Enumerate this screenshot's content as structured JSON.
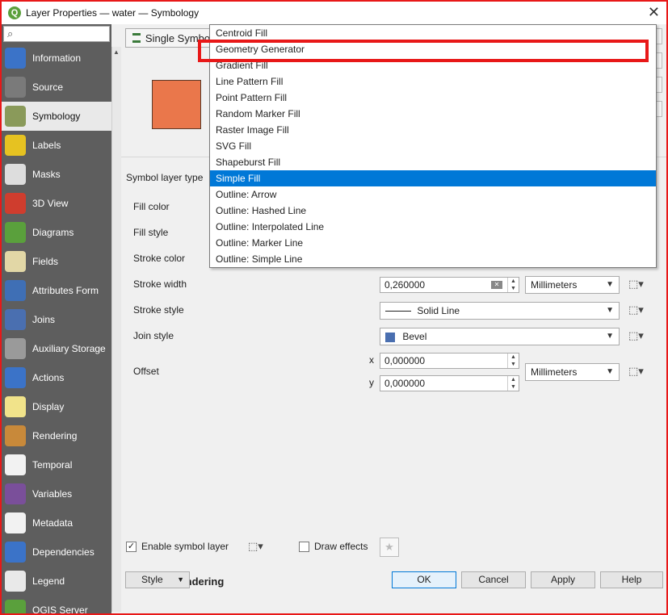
{
  "window": {
    "title": "Layer Properties — water — Symbology",
    "app_icon_letter": "Q"
  },
  "sidebar": {
    "items": [
      {
        "label": "Information",
        "icon": "info-icon",
        "color": "#3b73c8"
      },
      {
        "label": "Source",
        "icon": "source-gear-icon",
        "color": "#7a7a7a"
      },
      {
        "label": "Symbology",
        "icon": "paintbrush-icon",
        "color": "#8a9a5a",
        "active": true
      },
      {
        "label": "Labels",
        "icon": "abc-labels-icon",
        "color": "#e6c221"
      },
      {
        "label": "Masks",
        "icon": "abc-masks-icon",
        "color": "#dddddd"
      },
      {
        "label": "3D View",
        "icon": "cube-icon",
        "color": "#cf3d2e"
      },
      {
        "label": "Diagrams",
        "icon": "diagram-icon",
        "color": "#5aa03c"
      },
      {
        "label": "Fields",
        "icon": "fields-icon",
        "color": "#e2d7a6"
      },
      {
        "label": "Attributes Form",
        "icon": "form-icon",
        "color": "#3f6fb5"
      },
      {
        "label": "Joins",
        "icon": "joins-icon",
        "color": "#4a6fb0"
      },
      {
        "label": "Auxiliary Storage",
        "icon": "storage-icon",
        "color": "#9a9a9a"
      },
      {
        "label": "Actions",
        "icon": "actions-gear-icon",
        "color": "#3b73c8"
      },
      {
        "label": "Display",
        "icon": "speech-bubble-icon",
        "color": "#f1e38a"
      },
      {
        "label": "Rendering",
        "icon": "brush-icon",
        "color": "#c8893a"
      },
      {
        "label": "Temporal",
        "icon": "clock-icon",
        "color": "#f2f2f2"
      },
      {
        "label": "Variables",
        "icon": "epsilon-icon",
        "color": "#7a4f9a"
      },
      {
        "label": "Metadata",
        "icon": "metadata-icon",
        "color": "#f2f2f2"
      },
      {
        "label": "Dependencies",
        "icon": "dependencies-icon",
        "color": "#3b73c8"
      },
      {
        "label": "Legend",
        "icon": "legend-icon",
        "color": "#e9e9e9"
      },
      {
        "label": "QGIS Server",
        "icon": "server-icon",
        "color": "#5aa03c"
      }
    ]
  },
  "main": {
    "renderer": "Single Symbol",
    "symbol_layer_type_label": "Symbol layer type",
    "preview_fill_color": "#ea774b",
    "properties": {
      "fill_color_label": "Fill color",
      "fill_style_label": "Fill style",
      "stroke_color_label": "Stroke color",
      "stroke_width_label": "Stroke width",
      "stroke_width_value": "0,260000",
      "stroke_width_unit": "Millimeters",
      "stroke_style_label": "Stroke style",
      "stroke_style_value": "Solid Line",
      "join_style_label": "Join style",
      "join_style_value": "Bevel",
      "offset_label": "Offset",
      "offset_x_label": "x",
      "offset_x_value": "0,000000",
      "offset_y_label": "y",
      "offset_y_value": "0,000000",
      "offset_unit": "Millimeters"
    },
    "enable_symbol_layer_label": "Enable symbol layer",
    "enable_symbol_layer_checked": true,
    "draw_effects_label": "Draw effects",
    "draw_effects_checked": false,
    "layer_rendering_label": "Layer Rendering"
  },
  "dropdown": {
    "items": [
      "Centroid Fill",
      "Geometry Generator",
      "Gradient Fill",
      "Line Pattern Fill",
      "Point Pattern Fill",
      "Random Marker Fill",
      "Raster Image Fill",
      "SVG Fill",
      "Shapeburst Fill",
      "Simple Fill",
      "Outline: Arrow",
      "Outline: Hashed Line",
      "Outline: Interpolated Line",
      "Outline: Marker Line",
      "Outline: Simple Line"
    ],
    "selected": "Simple Fill",
    "highlighted": "Geometry Generator"
  },
  "buttons": {
    "style": "Style",
    "ok": "OK",
    "cancel": "Cancel",
    "apply": "Apply",
    "help": "Help"
  },
  "colors": {
    "accent": "#0078d7",
    "highlight_border": "#e81818",
    "sidebar_bg": "#5e5e5e"
  }
}
